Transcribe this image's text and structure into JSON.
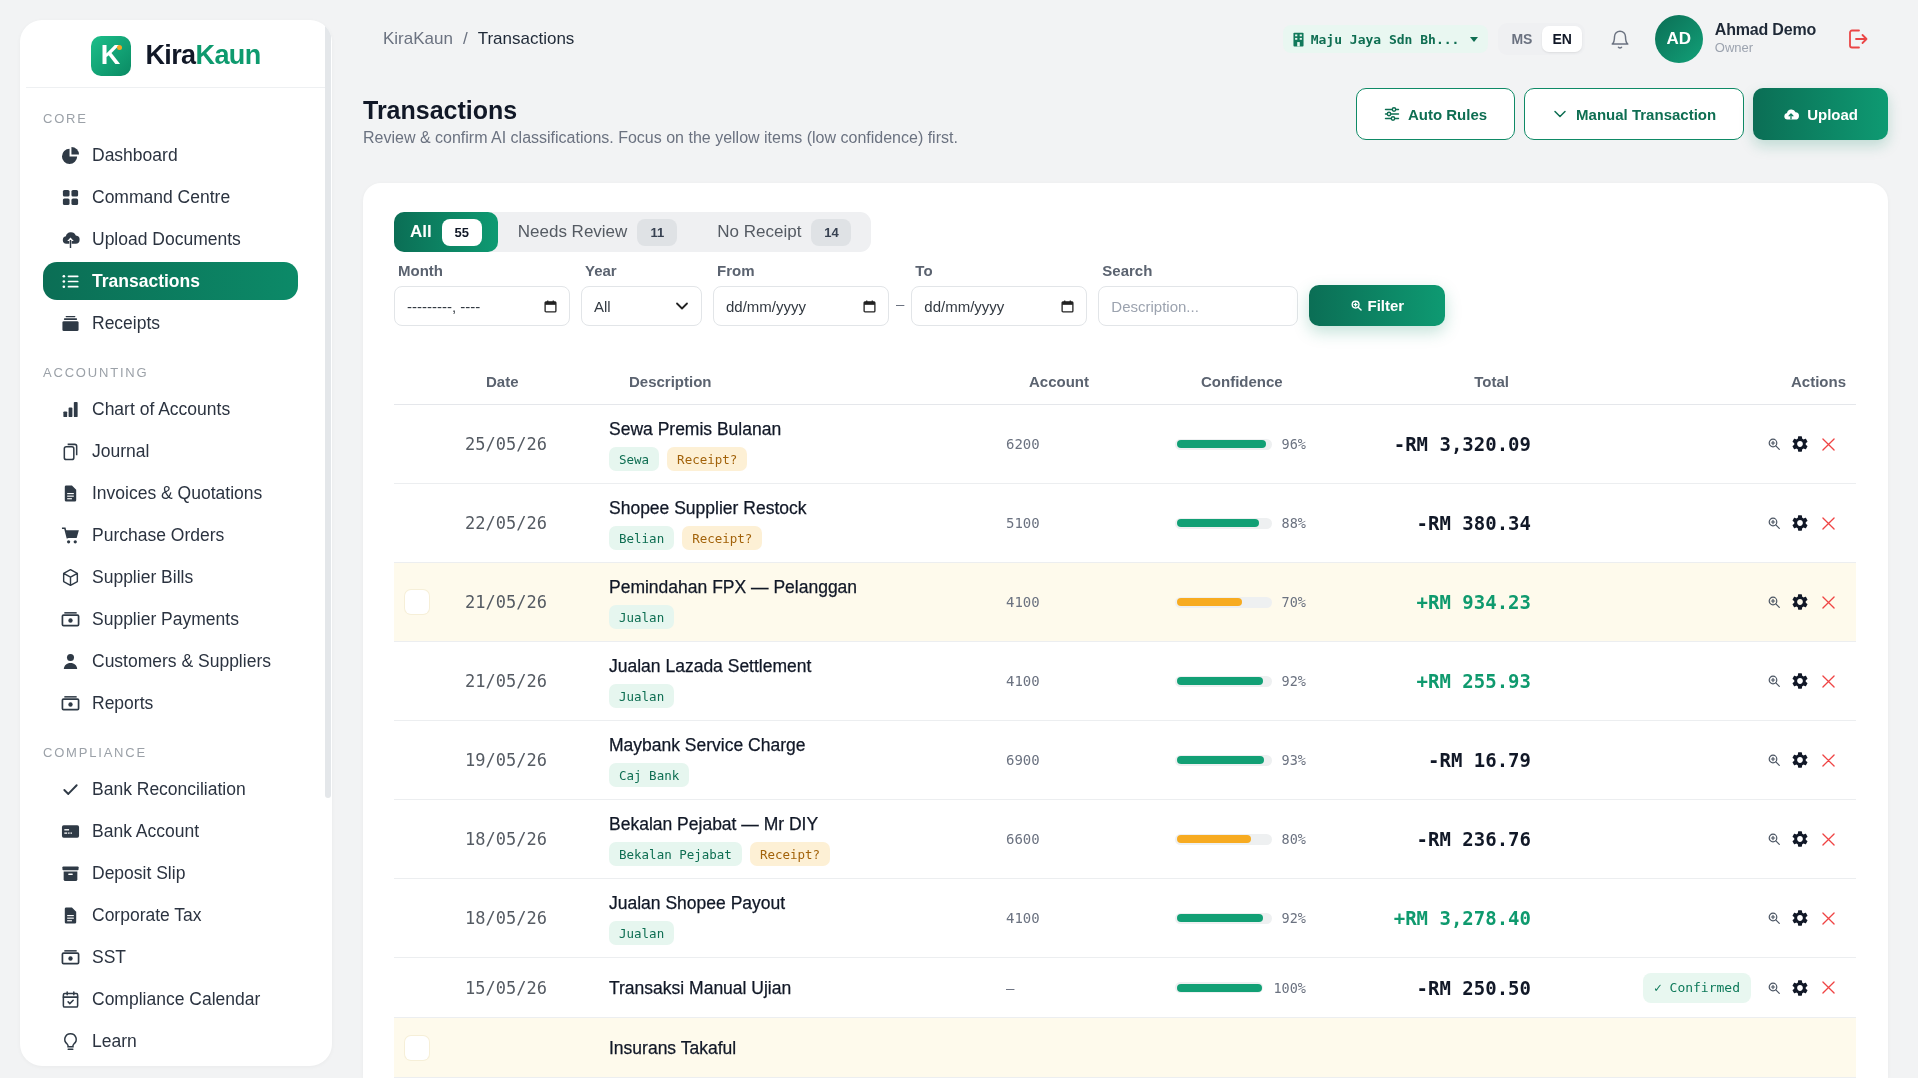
{
  "sidebar": {
    "brand": {
      "mark": "K",
      "name_parts": [
        "Kira",
        "Kaun"
      ]
    },
    "sections": [
      {
        "title": "CORE",
        "items": [
          {
            "label": "Dashboard",
            "selected": false
          },
          {
            "label": "Command Centre",
            "selected": false
          },
          {
            "label": "Upload Documents",
            "selected": false
          },
          {
            "label": "Transactions",
            "selected": true
          },
          {
            "label": "Receipts",
            "selected": false
          }
        ]
      },
      {
        "title": "ACCOUNTING",
        "items": [
          {
            "label": "Chart of Accounts",
            "selected": false
          },
          {
            "label": "Journal",
            "selected": false
          },
          {
            "label": "Invoices & Quotations",
            "selected": false
          },
          {
            "label": "Purchase Orders",
            "selected": false
          },
          {
            "label": "Supplier Bills",
            "selected": false
          },
          {
            "label": "Supplier Payments",
            "selected": false
          },
          {
            "label": "Customers & Suppliers",
            "selected": false
          },
          {
            "label": "Reports",
            "selected": false
          }
        ]
      },
      {
        "title": "COMPLIANCE",
        "items": [
          {
            "label": "Bank Reconciliation",
            "selected": false
          },
          {
            "label": "Bank Account",
            "selected": false
          },
          {
            "label": "Deposit Slip",
            "selected": false
          },
          {
            "label": "Corporate Tax",
            "selected": false
          },
          {
            "label": "SST",
            "selected": false
          },
          {
            "label": "Compliance Calendar",
            "selected": false
          },
          {
            "label": "Learn",
            "selected": false
          }
        ]
      }
    ]
  },
  "topbar": {
    "breadcrumb": {
      "separator": "/",
      "items": [
        {
          "label": "KiraKaun",
          "current": false
        },
        {
          "label": "Transactions",
          "current": true
        }
      ]
    },
    "company": {
      "name": "Maju Jaya Sdn Bh..."
    },
    "languages": [
      {
        "label": "MS",
        "selected": false
      },
      {
        "label": "EN",
        "selected": true
      }
    ],
    "user": {
      "initials": "AD",
      "name": "Ahmad Demo",
      "role": "Owner"
    }
  },
  "page": {
    "title": "Transactions",
    "subtitle": "Review & confirm AI classifications. Focus on the yellow items (low confidence) first.",
    "actions": [
      {
        "label": "Auto Rules",
        "kind": "outline"
      },
      {
        "label": "Manual Transaction",
        "kind": "outline"
      },
      {
        "label": "Upload",
        "kind": "primary"
      }
    ]
  },
  "tabs": [
    {
      "label": "All",
      "count": "55",
      "selected": true
    },
    {
      "label": "Needs Review",
      "count": "11",
      "selected": false
    },
    {
      "label": "No Receipt",
      "count": "14",
      "selected": false
    }
  ],
  "filters": {
    "fields": [
      {
        "kind": "date",
        "label": "Month",
        "placeholder": "---------, ----"
      },
      {
        "kind": "select",
        "label": "Year",
        "value": "All"
      },
      {
        "kind": "date",
        "label": "From",
        "placeholder": "dd/mm/yyyy"
      },
      {
        "kind": "separator",
        "text": "–"
      },
      {
        "kind": "date",
        "label": "To",
        "placeholder": "dd/mm/yyyy"
      },
      {
        "kind": "text",
        "label": "Search",
        "placeholder": "Description..."
      }
    ],
    "button": "Filter"
  },
  "table": {
    "columns": [
      "Date",
      "Description",
      "Account",
      "Confidence",
      "Total",
      "Actions"
    ],
    "rows": [
      {
        "highlighted": false,
        "date": "25/05/26",
        "description": "Sewa Premis Bulanan",
        "tags": [
          {
            "label": "Sewa",
            "kind": "category"
          },
          {
            "label": "Receipt?",
            "kind": "receipt"
          }
        ],
        "account": "6200",
        "confidence": {
          "level": 0.96,
          "reading": "96%"
        },
        "total": "-RM 3,320.09",
        "credit": false
      },
      {
        "highlighted": false,
        "date": "22/05/26",
        "description": "Shopee Supplier Restock",
        "tags": [
          {
            "label": "Belian",
            "kind": "category"
          },
          {
            "label": "Receipt?",
            "kind": "receipt"
          }
        ],
        "account": "5100",
        "confidence": {
          "level": 0.88,
          "reading": "88%"
        },
        "total": "-RM 380.34",
        "credit": false
      },
      {
        "highlighted": true,
        "date": "21/05/26",
        "description": "Pemindahan FPX — Pelanggan",
        "tags": [
          {
            "label": "Jualan",
            "kind": "category"
          }
        ],
        "account": "4100",
        "confidence": {
          "level": 0.7,
          "reading": "70%"
        },
        "total": "+RM 934.23",
        "credit": true
      },
      {
        "highlighted": false,
        "date": "21/05/26",
        "description": "Jualan Lazada Settlement",
        "tags": [
          {
            "label": "Jualan",
            "kind": "category"
          }
        ],
        "account": "4100",
        "confidence": {
          "level": 0.92,
          "reading": "92%"
        },
        "total": "+RM 255.93",
        "credit": true
      },
      {
        "highlighted": false,
        "date": "19/05/26",
        "description": "Maybank Service Charge",
        "tags": [
          {
            "label": "Caj Bank",
            "kind": "category"
          }
        ],
        "account": "6900",
        "confidence": {
          "level": 0.93,
          "reading": "93%"
        },
        "total": "-RM 16.79",
        "credit": false
      },
      {
        "highlighted": false,
        "date": "18/05/26",
        "description": "Bekalan Pejabat — Mr DIY",
        "tags": [
          {
            "label": "Bekalan Pejabat",
            "kind": "category"
          },
          {
            "label": "Receipt?",
            "kind": "receipt"
          }
        ],
        "account": "6600",
        "confidence": {
          "level": 0.8,
          "reading": "80%"
        },
        "total": "-RM 236.76",
        "credit": false
      },
      {
        "highlighted": false,
        "date": "18/05/26",
        "description": "Jualan Shopee Payout",
        "tags": [
          {
            "label": "Jualan",
            "kind": "category"
          }
        ],
        "account": "4100",
        "confidence": {
          "level": 0.92,
          "reading": "92%"
        },
        "total": "+RM 3,278.40",
        "credit": true
      },
      {
        "highlighted": false,
        "date": "15/05/26",
        "description": "Transaksi Manual Ujian",
        "account": "–",
        "confidence": {
          "level": 1.0,
          "reading": "100%"
        },
        "total": "-RM 250.50",
        "credit": false,
        "status": "✓ Confirmed"
      },
      {
        "highlighted": true,
        "description": "Insurans Takaful"
      }
    ]
  }
}
